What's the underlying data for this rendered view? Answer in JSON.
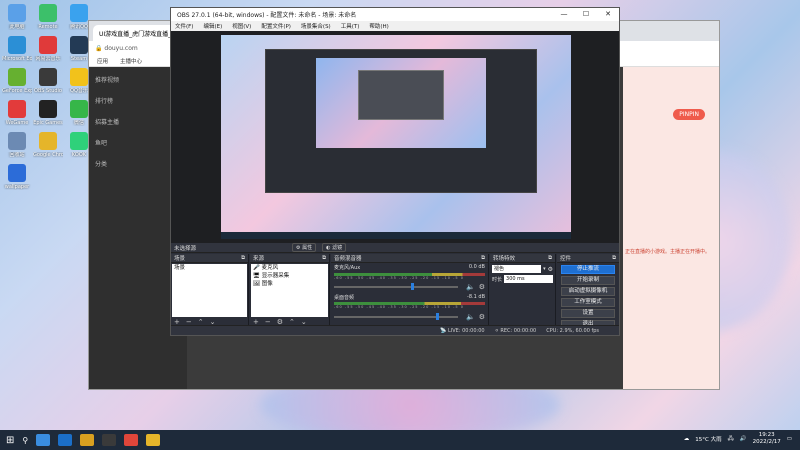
{
  "desktop": {
    "icons": [
      {
        "label": "此电脑",
        "color": "#5aa0e8"
      },
      {
        "label": "Remote",
        "color": "#3cc06a"
      },
      {
        "label": "腾讯QQ",
        "color": "#3aa2ee"
      },
      {
        "label": "Microsoft Edge",
        "color": "#2b8fd6"
      },
      {
        "label": "网易云音乐",
        "color": "#e03a3a"
      },
      {
        "label": "Steam",
        "color": "#233a55"
      },
      {
        "label": "GeForce Experience",
        "color": "#66b030"
      },
      {
        "label": "OBS Studio",
        "color": "#3a3a3a"
      },
      {
        "label": "QQ音乐",
        "color": "#f2c21b"
      },
      {
        "label": "WeGame",
        "color": "#e23b3b"
      },
      {
        "label": "Epic Games",
        "color": "#222222"
      },
      {
        "label": "微信",
        "color": "#36b649"
      },
      {
        "label": "回收站",
        "color": "#6c8ab3"
      },
      {
        "label": "Google Chrome",
        "color": "#e5b52a"
      },
      {
        "label": "KOOK",
        "color": "#2fd17a"
      },
      {
        "label": "wallpaper",
        "color": "#2c6cd8"
      }
    ]
  },
  "browser": {
    "tab_title": "UI游戏直播_虎门游戏直播_",
    "address": "douyu.com",
    "bookmarks": [
      "应用",
      "主播中心"
    ],
    "sidebar": [
      "推荐视频",
      "排行榜",
      "招募主播",
      "鱼吧",
      "分类"
    ],
    "right_button": "PINPIN",
    "right_text": "正在直播的小游戏。主播正在开播中。"
  },
  "obs": {
    "title": "OBS 27.0.1 (64-bit, windows) - 配置文件: 未命名 - 场景: 未命名",
    "window_buttons": {
      "minimize": "—",
      "maximize": "☐",
      "close": "✕"
    },
    "menu": [
      "文件(F)",
      "编辑(E)",
      "视图(V)",
      "配置文件(P)",
      "场景集合(S)",
      "工具(T)",
      "帮助(H)"
    ],
    "status_row": {
      "no_source": "未选择源",
      "properties": "属性",
      "filters": "滤镜"
    },
    "scenes": {
      "header": "场景",
      "items": [
        "场景"
      ]
    },
    "sources": {
      "header": "来源",
      "items": [
        "麦克风",
        "显示器采集",
        "图像"
      ]
    },
    "mixer": {
      "header": "音频混音器",
      "tracks": [
        {
          "name": "麦克风/Aux",
          "db": "0.0 dB",
          "level": 0.62
        },
        {
          "name": "桌面音频",
          "db": "-8.1 dB",
          "level": 0.82
        }
      ],
      "ticks": "-60 -55 -50 -45 -40 -35 -30 -25 -20 -15 -10 -5 0"
    },
    "transitions": {
      "header": "转场特效",
      "type": "褪色",
      "duration_label": "时长",
      "duration_value": "300 ms"
    },
    "controls": {
      "header": "控件",
      "buttons": [
        "停止推流",
        "开始录制",
        "启动虚拟摄像机",
        "工作室模式",
        "设置",
        "退出"
      ]
    },
    "statusbar": {
      "live": "LIVE: 00:00:00",
      "rec": "REC: 00:00:00",
      "cpu": "CPU: 2.9%, 60.00 fps"
    }
  },
  "taskbar": {
    "weather": "15°C 大雨",
    "time": "19:23",
    "date": "2022/2/17",
    "apps_colors": [
      "#3a8de0",
      "#1b6fc9",
      "#d9a020",
      "#3a3a3a",
      "#e0463a",
      "#e5b52a"
    ]
  }
}
